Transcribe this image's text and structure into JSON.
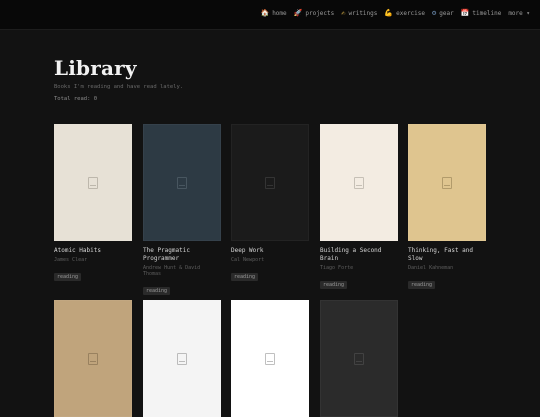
{
  "nav": {
    "items": [
      {
        "icon": "home-icon",
        "glyph": "🏠",
        "label": "home"
      },
      {
        "icon": "rocket-icon",
        "glyph": "🚀",
        "label": "projects"
      },
      {
        "icon": "writing-hand-icon",
        "glyph": "✍",
        "label": "writings"
      },
      {
        "icon": "flexed-biceps-icon",
        "glyph": "💪",
        "label": "exercise"
      },
      {
        "icon": "gear-icon",
        "glyph": "⚙",
        "label": "gear"
      },
      {
        "icon": "calendar-icon",
        "glyph": "📅",
        "label": "timeline"
      },
      {
        "icon": "chevron-down-icon",
        "glyph": "",
        "label": "more ▾"
      }
    ]
  },
  "page": {
    "title": "Library",
    "subtitle": "Books I'm reading and have read lately.",
    "total": "Total read: 0"
  },
  "books": [
    {
      "title": "Atomic Habits",
      "author": "James Clear",
      "status": "reading",
      "cover_color": "#e7e1d6",
      "icon_color": "#9c968b"
    },
    {
      "title": "The Pragmatic Programmer",
      "author": "Andrew Hunt & David Thomas",
      "status": "reading",
      "cover_color": "#2d3a44",
      "icon_color": "#5f6d78"
    },
    {
      "title": "Deep Work",
      "author": "Cal Newport",
      "status": "reading",
      "cover_color": "#1b1b1b",
      "icon_color": "#4a4a4a"
    },
    {
      "title": "Building a Second Brain",
      "author": "Tiago Forte",
      "status": "reading",
      "cover_color": "#f3ece2",
      "icon_color": "#a39d93"
    },
    {
      "title": "Thinking, Fast and Slow",
      "author": "Daniel Kahneman",
      "status": "reading",
      "cover_color": "#dfc58f",
      "icon_color": "#8f7a4f"
    },
    {
      "title": "",
      "author": "",
      "status": "",
      "cover_color": "#c0a47c",
      "icon_color": "#7a6548"
    },
    {
      "title": "",
      "author": "",
      "status": "",
      "cover_color": "#f4f4f4",
      "icon_color": "#8e8e8e"
    },
    {
      "title": "",
      "author": "",
      "status": "",
      "cover_color": "#ffffff",
      "icon_color": "#8e8e8e"
    },
    {
      "title": "",
      "author": "",
      "status": "",
      "cover_color": "#2b2b2b",
      "icon_color": "#555555"
    }
  ]
}
